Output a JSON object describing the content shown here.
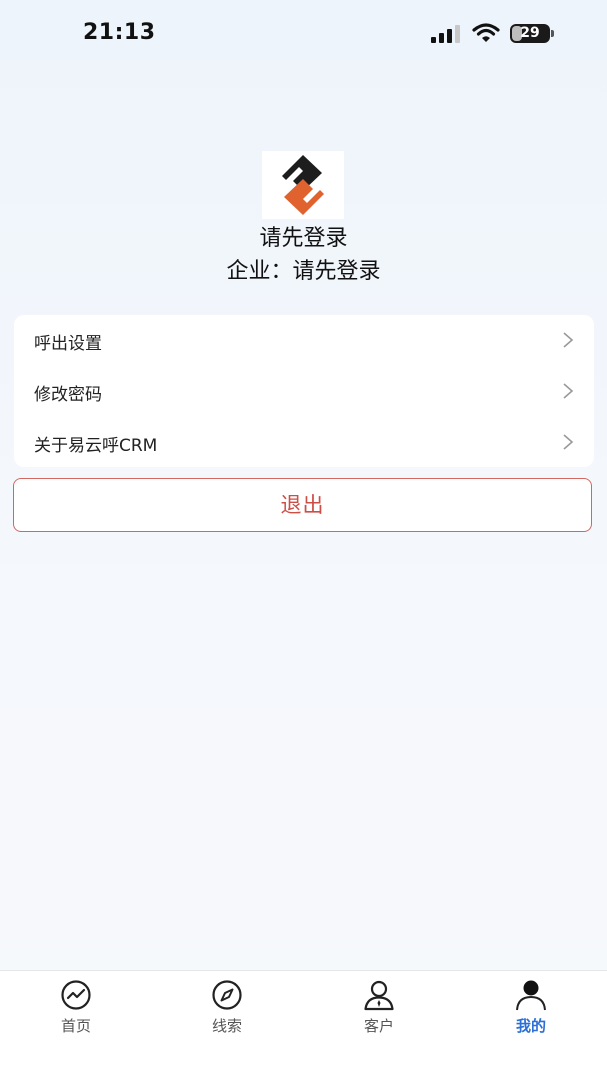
{
  "status_bar": {
    "time": "21:13",
    "battery": "29",
    "battery_level": 0.29
  },
  "profile": {
    "user_name": "请先登录",
    "company_label": "企业：",
    "company_value": "请先登录"
  },
  "menu": {
    "items": [
      {
        "label": "呼出设置"
      },
      {
        "label": "修改密码"
      },
      {
        "label": "关于易云呼CRM"
      }
    ]
  },
  "logout": {
    "label": "退出"
  },
  "tabs": [
    {
      "label": "首页",
      "icon": "chart-line-icon"
    },
    {
      "label": "线索",
      "icon": "compass-icon"
    },
    {
      "label": "客户",
      "icon": "customer-icon"
    },
    {
      "label": "我的",
      "icon": "user-icon",
      "active": true
    }
  ],
  "colors": {
    "accent": "#2d6fd8",
    "danger": "#cc4f47",
    "logo_orange": "#e0622f"
  }
}
